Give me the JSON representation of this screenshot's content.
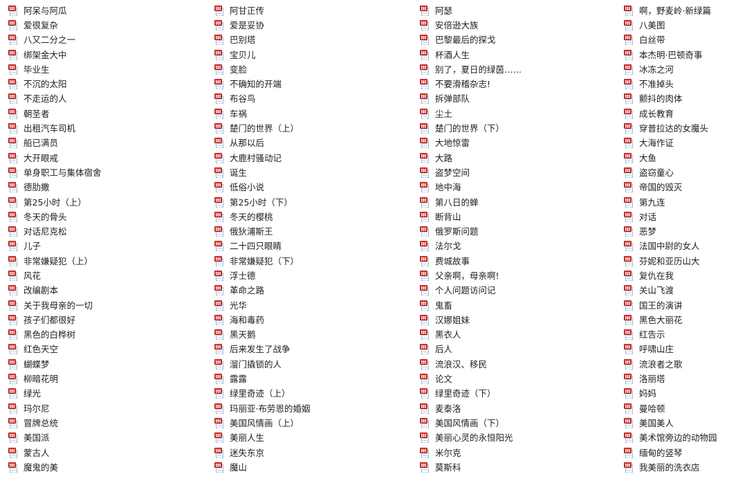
{
  "view": {
    "name": "file-browser-list",
    "icon_type": "rtf-document-icon",
    "accent_color": "#d4322c",
    "sheet_border_color": "#9cb8d4",
    "text_color": "#1d1d1d",
    "background": "#ffffff",
    "column_count": 4,
    "rows_per_column": 32
  },
  "columns": [
    {
      "index": 1,
      "items": [
        {
          "label": "阿呆与阿瓜"
        },
        {
          "label": "爱很复杂"
        },
        {
          "label": "八又二分之一"
        },
        {
          "label": "绑架金大中"
        },
        {
          "label": "毕业生"
        },
        {
          "label": "不沉的太阳"
        },
        {
          "label": "不走运的人"
        },
        {
          "label": "朝圣者"
        },
        {
          "label": "出租汽车司机"
        },
        {
          "label": "船已满员"
        },
        {
          "label": "大开眼戒"
        },
        {
          "label": "单身职工与集体宿舍"
        },
        {
          "label": "德肋撒"
        },
        {
          "label": "第25小时（上）"
        },
        {
          "label": "冬天的骨头"
        },
        {
          "label": "对话尼克松"
        },
        {
          "label": "儿子"
        },
        {
          "label": "非常嫌疑犯（上）"
        },
        {
          "label": "风花"
        },
        {
          "label": "改编剧本"
        },
        {
          "label": "关于我母亲的一切"
        },
        {
          "label": "孩子们都很好"
        },
        {
          "label": "黑色的白桦树"
        },
        {
          "label": "红色天空"
        },
        {
          "label": "蝴蝶梦"
        },
        {
          "label": "柳暗花明"
        },
        {
          "label": "绿光"
        },
        {
          "label": "玛尔尼"
        },
        {
          "label": "冒牌总统"
        },
        {
          "label": "美国派"
        },
        {
          "label": "蒙古人"
        },
        {
          "label": "魔鬼的美"
        }
      ]
    },
    {
      "index": 2,
      "items": [
        {
          "label": "阿甘正传"
        },
        {
          "label": "爱是妥协"
        },
        {
          "label": "巴别塔"
        },
        {
          "label": "宝贝儿"
        },
        {
          "label": "变脸"
        },
        {
          "label": "不确知的开端"
        },
        {
          "label": "布谷鸟"
        },
        {
          "label": "车祸"
        },
        {
          "label": "楚门的世界（上）"
        },
        {
          "label": "从那以后"
        },
        {
          "label": "大鹿村骚动记"
        },
        {
          "label": "诞生"
        },
        {
          "label": "低俗小说"
        },
        {
          "label": "第25小时（下）"
        },
        {
          "label": "冬天的樱桃"
        },
        {
          "label": "俄狄浦斯王"
        },
        {
          "label": "二十四只眼睛"
        },
        {
          "label": "非常嫌疑犯（下）"
        },
        {
          "label": "浮士德"
        },
        {
          "label": "革命之路"
        },
        {
          "label": "光华"
        },
        {
          "label": "海和毒药"
        },
        {
          "label": "黑天鹅"
        },
        {
          "label": "后来发生了战争"
        },
        {
          "label": "溜门撬锁的人"
        },
        {
          "label": "露露"
        },
        {
          "label": "绿里奇迹（上）"
        },
        {
          "label": "玛丽亚·布劳恩的婚姻"
        },
        {
          "label": "美国风情画（上）"
        },
        {
          "label": "美丽人生"
        },
        {
          "label": "迷失东京"
        },
        {
          "label": "魔山"
        }
      ]
    },
    {
      "index": 3,
      "items": [
        {
          "label": "阿瑟"
        },
        {
          "label": "安倍逊大族"
        },
        {
          "label": "巴黎最后的探戈"
        },
        {
          "label": "杯酒人生"
        },
        {
          "label": "别了，夏日的绿茵……"
        },
        {
          "label": "不要滑稽杂志!"
        },
        {
          "label": "拆弹部队"
        },
        {
          "label": "尘土"
        },
        {
          "label": "楚门的世界（下）"
        },
        {
          "label": "大地惊雷"
        },
        {
          "label": "大路"
        },
        {
          "label": "盗梦空间"
        },
        {
          "label": "地中海"
        },
        {
          "label": "第八日的蝉"
        },
        {
          "label": "断背山"
        },
        {
          "label": "俄罗斯问题"
        },
        {
          "label": "法尔戈"
        },
        {
          "label": "费城故事"
        },
        {
          "label": "父亲啊，母亲啊!"
        },
        {
          "label": "个人问题访问记"
        },
        {
          "label": "鬼畜"
        },
        {
          "label": "汉娜姐妹"
        },
        {
          "label": "黑衣人"
        },
        {
          "label": "后人"
        },
        {
          "label": "流浪汉、移民"
        },
        {
          "label": "论文"
        },
        {
          "label": "绿里奇迹（下）"
        },
        {
          "label": "麦泰洛"
        },
        {
          "label": "美国风情画（下）"
        },
        {
          "label": "美丽心灵的永恒阳光"
        },
        {
          "label": "米尔克"
        },
        {
          "label": "莫斯科"
        }
      ]
    },
    {
      "index": 4,
      "items": [
        {
          "label": "啊，野麦岭·新绿篇"
        },
        {
          "label": "八美图"
        },
        {
          "label": "白丝带"
        },
        {
          "label": "本杰明·巴顿奇事"
        },
        {
          "label": "冰冻之河"
        },
        {
          "label": "不准掉头"
        },
        {
          "label": "颤抖的肉体"
        },
        {
          "label": "成长教育"
        },
        {
          "label": "穿普拉达的女魔头"
        },
        {
          "label": "大海作证"
        },
        {
          "label": "大鱼"
        },
        {
          "label": "盗窃童心"
        },
        {
          "label": "帝国的毁灭"
        },
        {
          "label": "第九连"
        },
        {
          "label": "对话"
        },
        {
          "label": "恶梦"
        },
        {
          "label": "法国中尉的女人"
        },
        {
          "label": "芬妮和亚历山大"
        },
        {
          "label": "复仇在我"
        },
        {
          "label": "关山飞渡"
        },
        {
          "label": "国王的演讲"
        },
        {
          "label": "黑色大丽花"
        },
        {
          "label": "红告示"
        },
        {
          "label": "呼啸山庄"
        },
        {
          "label": "流浪者之歌"
        },
        {
          "label": "洛丽塔"
        },
        {
          "label": "妈妈"
        },
        {
          "label": "曼哈顿"
        },
        {
          "label": "美国美人"
        },
        {
          "label": "美术馆旁边的动物园"
        },
        {
          "label": "缅甸的竖琴"
        },
        {
          "label": "我美丽的洗衣店"
        }
      ]
    }
  ]
}
